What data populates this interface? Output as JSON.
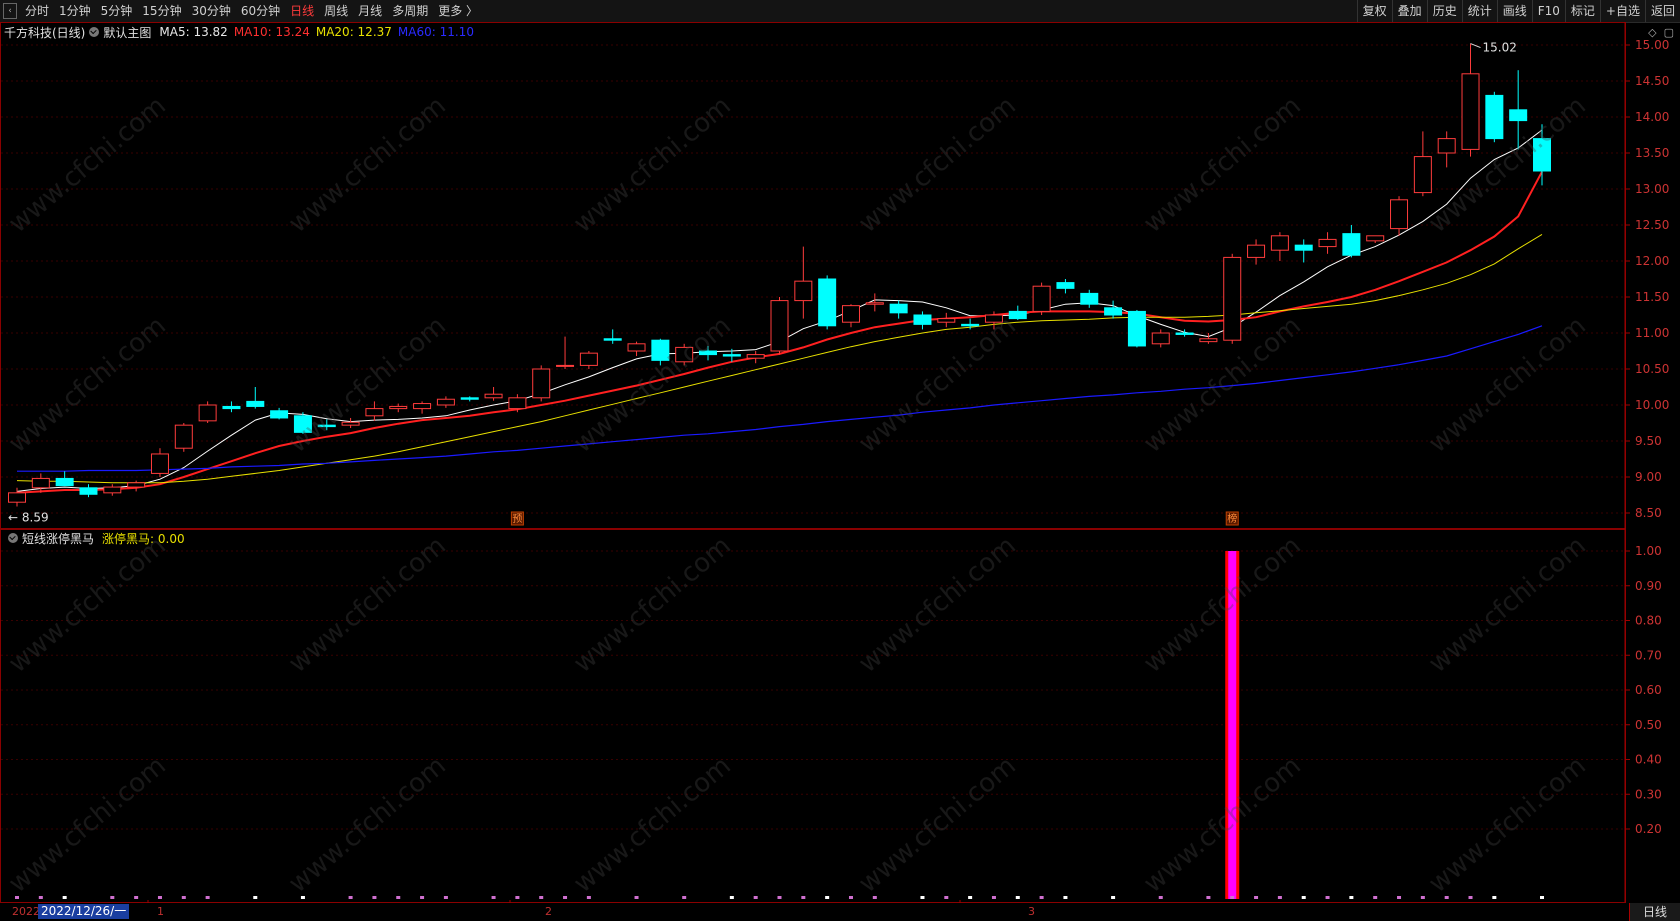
{
  "toolbar": {
    "periods": [
      "分时",
      "1分钟",
      "5分钟",
      "15分钟",
      "30分钟",
      "60分钟",
      "日线",
      "周线",
      "月线",
      "多周期",
      "更多 〉"
    ],
    "active_period": "日线",
    "right_buttons": [
      "复权",
      "叠加",
      "历史",
      "统计",
      "画线",
      "F10",
      "标记",
      "+自选",
      "返回"
    ]
  },
  "main_legend": {
    "stock": "千方科技(日线)",
    "template": "默认主图",
    "ma5": "MA5: 13.82",
    "ma10": "MA10: 13.24",
    "ma20": "MA20: 12.37",
    "ma60": "MA60: 11.10"
  },
  "sub_legend": {
    "indicator": "短线涨停黑马",
    "value": "涨停黑马: 0.00"
  },
  "markers": {
    "high_label": "15.02",
    "low_label": "8.59",
    "signal_yu": "预",
    "signal_bang": "榜"
  },
  "watermark": "www.cfchi.com",
  "bottom": {
    "year": "2022",
    "date": "2022/12/26/一",
    "months": [
      "1",
      "2",
      "3"
    ],
    "period_tag": "日线"
  },
  "colors": {
    "up": "#ff3c3c",
    "down": "#00ffff",
    "ma5": "#ffffff",
    "ma10": "#ff2020",
    "ma20": "#e8e000",
    "ma60": "#1a1aff",
    "signal_bar": "#ff00ff"
  },
  "chart_data": [
    {
      "type": "candlestick",
      "title": "千方科技(日线)",
      "y_ticks": [
        "15.00",
        "14.50",
        "14.00",
        "13.50",
        "13.00",
        "12.50",
        "12.00",
        "11.50",
        "11.00",
        "10.50",
        "10.00",
        "9.50",
        "9.00",
        "8.50"
      ],
      "ylim": [
        8.35,
        15.15
      ],
      "candles": [
        [
          8.65,
          8.85,
          8.59,
          8.78
        ],
        [
          8.85,
          9.05,
          8.78,
          8.98
        ],
        [
          8.98,
          9.08,
          8.9,
          8.88
        ],
        [
          8.85,
          8.9,
          8.72,
          8.76
        ],
        [
          8.78,
          8.9,
          8.74,
          8.86
        ],
        [
          8.86,
          8.95,
          8.8,
          8.92
        ],
        [
          9.05,
          9.4,
          9.0,
          9.32
        ],
        [
          9.4,
          9.75,
          9.35,
          9.72
        ],
        [
          9.78,
          10.05,
          9.75,
          10.0
        ],
        [
          9.98,
          10.05,
          9.9,
          9.95
        ],
        [
          10.05,
          10.25,
          9.95,
          9.98
        ],
        [
          9.92,
          9.96,
          9.8,
          9.82
        ],
        [
          9.85,
          9.9,
          9.6,
          9.62
        ],
        [
          9.72,
          9.8,
          9.65,
          9.7
        ],
        [
          9.72,
          9.82,
          9.68,
          9.76
        ],
        [
          9.85,
          10.05,
          9.78,
          9.95
        ],
        [
          9.95,
          10.02,
          9.9,
          9.98
        ],
        [
          9.95,
          10.05,
          9.88,
          10.02
        ],
        [
          10.0,
          10.12,
          9.96,
          10.08
        ],
        [
          10.1,
          10.12,
          10.05,
          10.08
        ],
        [
          10.1,
          10.25,
          10.06,
          10.15
        ],
        [
          9.95,
          10.15,
          9.9,
          10.1
        ],
        [
          10.1,
          10.55,
          10.05,
          10.5
        ],
        [
          10.55,
          10.95,
          10.5,
          10.55
        ],
        [
          10.55,
          10.75,
          10.5,
          10.72
        ],
        [
          10.92,
          11.05,
          10.85,
          10.9
        ],
        [
          10.75,
          10.88,
          10.68,
          10.85
        ],
        [
          10.9,
          10.92,
          10.55,
          10.62
        ],
        [
          10.6,
          10.85,
          10.55,
          10.8
        ],
        [
          10.75,
          10.82,
          10.62,
          10.7
        ],
        [
          10.7,
          10.78,
          10.6,
          10.68
        ],
        [
          10.65,
          10.75,
          10.58,
          10.7
        ],
        [
          10.75,
          11.5,
          10.7,
          11.45
        ],
        [
          11.45,
          12.2,
          11.2,
          11.72
        ],
        [
          11.75,
          11.8,
          11.05,
          11.1
        ],
        [
          11.15,
          11.4,
          11.08,
          11.38
        ],
        [
          11.4,
          11.55,
          11.3,
          11.42
        ],
        [
          11.4,
          11.45,
          11.2,
          11.28
        ],
        [
          11.25,
          11.3,
          11.05,
          11.12
        ],
        [
          11.15,
          11.28,
          11.08,
          11.2
        ],
        [
          11.12,
          11.2,
          11.05,
          11.1
        ],
        [
          11.15,
          11.3,
          11.05,
          11.25
        ],
        [
          11.3,
          11.38,
          11.18,
          11.2
        ],
        [
          11.3,
          11.7,
          11.25,
          11.65
        ],
        [
          11.7,
          11.75,
          11.55,
          11.62
        ],
        [
          11.55,
          11.6,
          11.35,
          11.4
        ],
        [
          11.35,
          11.45,
          11.2,
          11.25
        ],
        [
          11.3,
          11.32,
          10.8,
          10.82
        ],
        [
          10.85,
          11.05,
          10.8,
          11.0
        ],
        [
          11.0,
          11.05,
          10.95,
          10.98
        ],
        [
          10.88,
          11.0,
          10.85,
          10.92
        ],
        [
          10.9,
          12.1,
          10.85,
          12.05
        ],
        [
          12.05,
          12.3,
          11.95,
          12.22
        ],
        [
          12.15,
          12.4,
          12.0,
          12.35
        ],
        [
          12.22,
          12.3,
          11.98,
          12.15
        ],
        [
          12.2,
          12.4,
          12.1,
          12.3
        ],
        [
          12.38,
          12.5,
          12.05,
          12.08
        ],
        [
          12.28,
          12.35,
          12.25,
          12.35
        ],
        [
          12.45,
          12.9,
          12.35,
          12.85
        ],
        [
          12.95,
          13.8,
          12.9,
          13.45
        ],
        [
          13.5,
          13.8,
          13.3,
          13.7
        ],
        [
          13.55,
          15.02,
          13.45,
          14.6
        ],
        [
          14.3,
          14.35,
          13.65,
          13.7
        ],
        [
          14.1,
          14.65,
          13.55,
          13.95
        ],
        [
          13.7,
          13.9,
          13.05,
          13.25
        ]
      ],
      "ma_series": [
        {
          "name": "MA5",
          "values": [
            8.8,
            8.84,
            8.86,
            8.84,
            8.85,
            8.88,
            8.97,
            9.13,
            9.36,
            9.58,
            9.79,
            9.89,
            9.87,
            9.81,
            9.77,
            9.79,
            9.8,
            9.82,
            9.85,
            9.93,
            10.0,
            10.06,
            10.16,
            10.28,
            10.39,
            10.52,
            10.64,
            10.71,
            10.72,
            10.74,
            10.75,
            10.77,
            10.88,
            11.06,
            11.17,
            11.31,
            11.46,
            11.45,
            11.43,
            11.35,
            11.24,
            11.24,
            11.25,
            11.32,
            11.4,
            11.42,
            11.38,
            11.24,
            11.12,
            11.01,
            10.95,
            11.08,
            11.29,
            11.52,
            11.71,
            11.92,
            12.08,
            12.2,
            12.36,
            12.55,
            12.79,
            13.15,
            13.41,
            13.57,
            13.82
          ]
        },
        {
          "name": "MA10",
          "values": [
            8.78,
            8.8,
            8.82,
            8.82,
            8.83,
            8.85,
            8.9,
            9.0,
            9.11,
            9.22,
            9.33,
            9.43,
            9.5,
            9.56,
            9.61,
            9.68,
            9.74,
            9.79,
            9.82,
            9.85,
            9.9,
            9.94,
            10.0,
            10.06,
            10.13,
            10.2,
            10.27,
            10.35,
            10.43,
            10.52,
            10.6,
            10.66,
            10.71,
            10.8,
            10.91,
            11.0,
            11.08,
            11.13,
            11.18,
            11.2,
            11.22,
            11.25,
            11.28,
            11.3,
            11.3,
            11.3,
            11.29,
            11.27,
            11.22,
            11.17,
            11.16,
            11.18,
            11.22,
            11.3,
            11.37,
            11.43,
            11.5,
            11.6,
            11.72,
            11.85,
            11.98,
            12.15,
            12.34,
            12.62,
            13.24
          ]
        },
        {
          "name": "MA20",
          "values": [
            8.95,
            8.94,
            8.94,
            8.93,
            8.92,
            8.92,
            8.92,
            8.94,
            8.97,
            9.01,
            9.05,
            9.09,
            9.14,
            9.19,
            9.24,
            9.29,
            9.35,
            9.42,
            9.49,
            9.56,
            9.63,
            9.7,
            9.77,
            9.85,
            9.93,
            10.01,
            10.09,
            10.17,
            10.25,
            10.33,
            10.41,
            10.49,
            10.57,
            10.65,
            10.73,
            10.81,
            10.88,
            10.94,
            11.0,
            11.05,
            11.08,
            11.12,
            11.15,
            11.17,
            11.18,
            11.19,
            11.21,
            11.22,
            11.22,
            11.22,
            11.23,
            11.25,
            11.28,
            11.31,
            11.34,
            11.37,
            11.4,
            11.45,
            11.52,
            11.6,
            11.69,
            11.81,
            11.96,
            12.17,
            12.37
          ]
        },
        {
          "name": "MA60",
          "values": [
            9.08,
            9.08,
            9.08,
            9.09,
            9.09,
            9.09,
            9.1,
            9.11,
            9.12,
            9.14,
            9.15,
            9.16,
            9.18,
            9.19,
            9.21,
            9.23,
            9.25,
            9.27,
            9.29,
            9.32,
            9.35,
            9.37,
            9.4,
            9.43,
            9.46,
            9.49,
            9.52,
            9.55,
            9.58,
            9.6,
            9.63,
            9.66,
            9.7,
            9.73,
            9.77,
            9.8,
            9.83,
            9.86,
            9.9,
            9.93,
            9.96,
            10.0,
            10.03,
            10.06,
            10.09,
            10.12,
            10.14,
            10.17,
            10.19,
            10.22,
            10.24,
            10.27,
            10.3,
            10.34,
            10.38,
            10.42,
            10.46,
            10.51,
            10.56,
            10.62,
            10.68,
            10.78,
            10.88,
            10.98,
            11.1
          ]
        }
      ]
    },
    {
      "type": "bar",
      "title": "短线涨停黑马",
      "y_ticks": [
        "1.00",
        "0.90",
        "0.80",
        "0.70",
        "0.60",
        "0.50",
        "0.40",
        "0.30",
        "0.20"
      ],
      "ylim": [
        0,
        1.0
      ],
      "signal_values": [
        0,
        0,
        0,
        0,
        0,
        0,
        0,
        0,
        0,
        0,
        0,
        0,
        0,
        0,
        0,
        0,
        0,
        0,
        0,
        0,
        0,
        0,
        0,
        0,
        0,
        0,
        0,
        0,
        0,
        0,
        0,
        0,
        0,
        0,
        0,
        0,
        0,
        0,
        0,
        0,
        0,
        0,
        0,
        0,
        0,
        0,
        0,
        0,
        0,
        0,
        0,
        1,
        0,
        0,
        0,
        0,
        0,
        0,
        0,
        0,
        0,
        0,
        0,
        0,
        0
      ]
    }
  ]
}
